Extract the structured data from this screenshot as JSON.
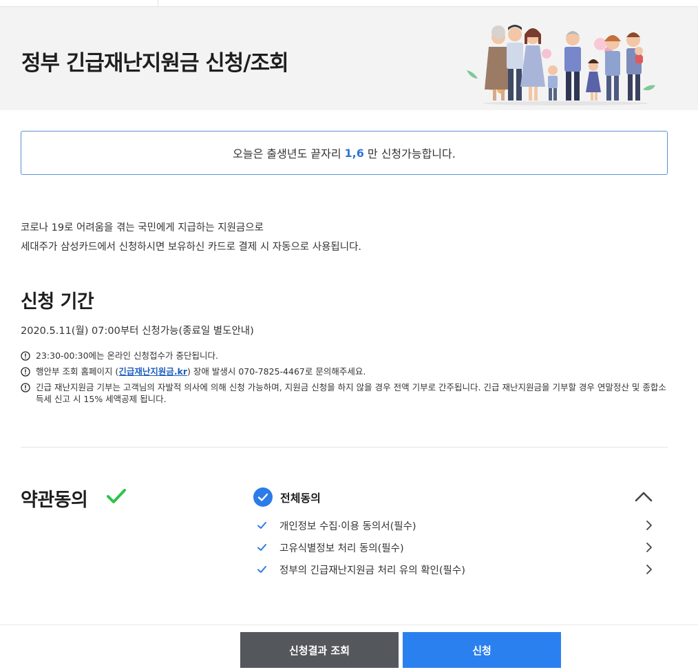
{
  "hero": {
    "title_prefix": "정부 긴급재난지원금 ",
    "title_bold": "신청/조회"
  },
  "notice": {
    "before": "오늘은 출생년도 끝자리",
    "highlight": "1,6",
    "after": "만 신청가능합니다."
  },
  "intro": {
    "line1": "코로나 19로 어려움을 겪는 국민에게 지급하는 지원금으로",
    "line2": "세대주가 삼성카드에서 신청하시면 보유하신 카드로 결제 시 자동으로 사용됩니다."
  },
  "period": {
    "title": "신청 기간",
    "date": "2020.5.11(월) 07:00부터 신청가능(종료일 별도안내)",
    "notes": {
      "n1": "23:30-00:30에는 온라인 신청접수가 중단됩니다.",
      "n2_before": "행안부 조회 홈페이지 (",
      "n2_link": "긴급재난지원금.kr",
      "n2_after": ") 장애 발생시 070-7825-4467로 문의해주세요.",
      "n3": "긴급 재난지원금 기부는 고객님의 자발적 의사에 의해 신청 가능하며, 지원금 신청을 하지 않을 경우 전액 기부로 간주됩니다. 긴급 재난지원금을 기부할 경우 연말정산 및 종합소득세 신고 시 15% 세액공제 됩니다."
    }
  },
  "terms": {
    "title": "약관동의",
    "all_label": "전체동의",
    "items": [
      {
        "label": "개인정보 수집·이용 동의서(필수)"
      },
      {
        "label": "고유식별정보 처리 동의(필수)"
      },
      {
        "label": "정부의 긴급재난지원금 처리 유의 확인(필수)"
      }
    ]
  },
  "footer": {
    "result_label": "신청결과 조회",
    "apply_label": "신청"
  },
  "colors": {
    "accent_blue": "#2b80f0",
    "check_green": "#2ec24a",
    "dark_button": "#54575c",
    "hero_bg": "#f3f3f3"
  }
}
